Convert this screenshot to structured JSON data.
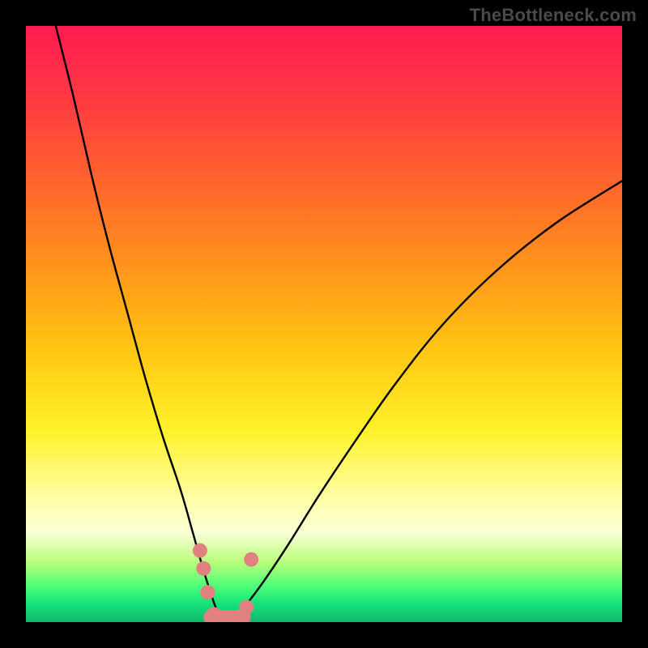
{
  "watermark": "TheBottleneck.com",
  "colors": {
    "background": "#000000",
    "curve": "#000000",
    "dots": "#e08080",
    "sweet_region": "#e08080",
    "gradient_top": "#ff1a52",
    "gradient_bottom": "#0fb86e"
  },
  "chart_data": {
    "type": "line",
    "title": "",
    "xlabel": "",
    "ylabel": "",
    "xlim": [
      0,
      100
    ],
    "ylim": [
      0,
      100
    ],
    "grid": false,
    "description": "Two smooth curves descending from the top edge to a common minimum near x≈33, y≈0, then the right curve rises back toward the upper right. A cluster of pink dots and a thick pink region mark the minimum (sweet spot).",
    "series": [
      {
        "name": "left-branch",
        "x": [
          5,
          8,
          11,
          14,
          17,
          20,
          23,
          26,
          28,
          30,
          32,
          33
        ],
        "y": [
          100,
          88,
          75,
          63,
          52,
          41,
          31,
          22,
          15,
          8,
          2,
          0
        ]
      },
      {
        "name": "right-branch",
        "x": [
          33,
          35,
          37,
          40,
          44,
          49,
          55,
          62,
          70,
          79,
          89,
          100
        ],
        "y": [
          0,
          1,
          3,
          7,
          13,
          21,
          30,
          40,
          50,
          59,
          67,
          74
        ]
      }
    ],
    "sweet_spot": {
      "x_range": [
        29,
        38
      ],
      "y_range": [
        0,
        12
      ],
      "dots": [
        {
          "x": 29.2,
          "y": 12
        },
        {
          "x": 29.8,
          "y": 9
        },
        {
          "x": 30.5,
          "y": 5
        },
        {
          "x": 31.5,
          "y": 1.3
        },
        {
          "x": 33.0,
          "y": 0.6
        },
        {
          "x": 34.5,
          "y": 0.6
        },
        {
          "x": 36.0,
          "y": 0.9
        },
        {
          "x": 37.0,
          "y": 2.5
        },
        {
          "x": 37.8,
          "y": 10.5
        }
      ]
    }
  }
}
